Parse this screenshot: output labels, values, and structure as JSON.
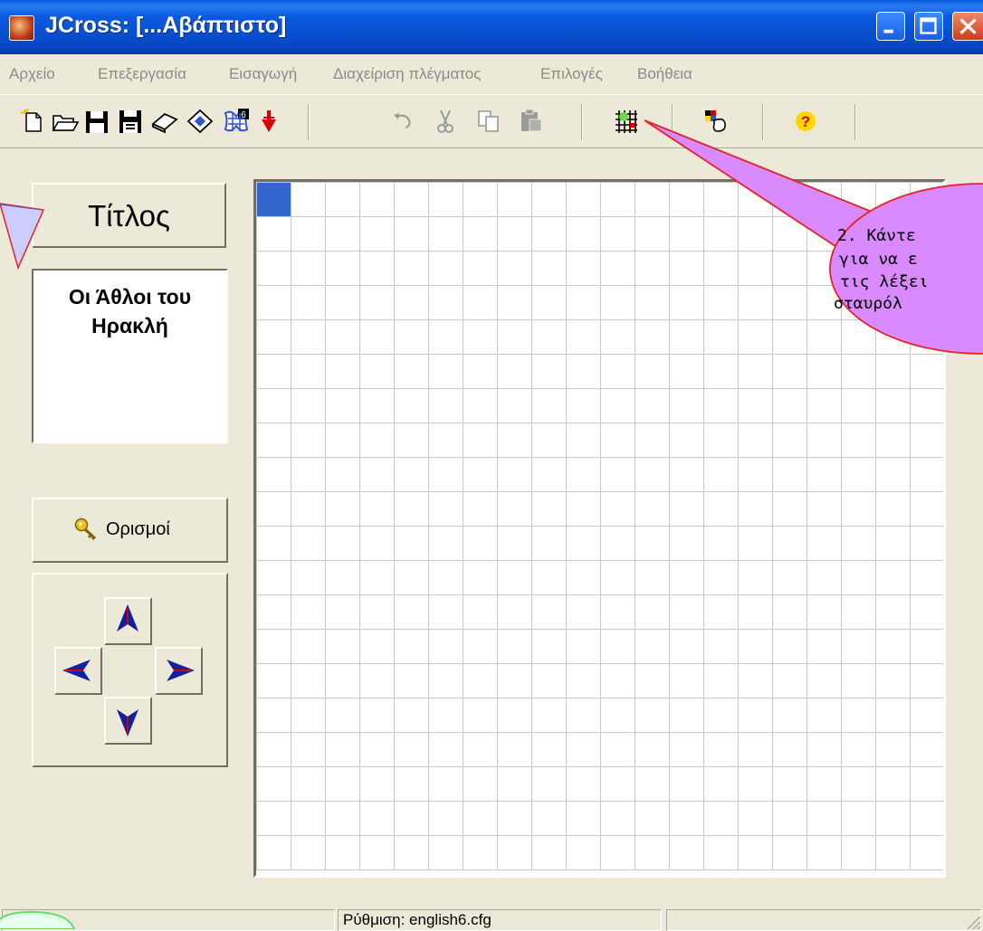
{
  "window": {
    "title": "JCross: [...Αβάπτιστο]"
  },
  "menu": [
    "Αρχείο",
    "Επεξεργασία",
    "Εισαγωγή",
    "Διαχείριση πλέγματος",
    "Επιλογές",
    "Βοήθεια"
  ],
  "toolbar": {
    "buttons": [
      "new-file",
      "open-file",
      "save",
      "save-as",
      "erase",
      "web-page",
      "export-hot-potatoes",
      "add-to-masher",
      "undo",
      "cut",
      "copy",
      "paste",
      "automatic-grid-maker",
      "display-options",
      "help"
    ]
  },
  "side_panel": {
    "title_button": "Τίτλος",
    "title_lines": [
      "Οι Άθλοι του",
      "Ηρακλή"
    ],
    "definitions_button": "Ορισμοί"
  },
  "grid": {
    "rows": 20,
    "cols": 20,
    "selected_cell": [
      0,
      0
    ]
  },
  "callout": {
    "lines": [
      "2. Κάντε",
      "για να ε",
      "τις λέξει",
      "σταυρόλ"
    ]
  },
  "status": {
    "config": "Ρύθμιση: english6.cfg"
  },
  "colors": {
    "titlebar": "#0a5ae0",
    "callout_fill": "#d98aff",
    "callout_border": "#e0242a",
    "selected_cell": "#3366cc"
  }
}
